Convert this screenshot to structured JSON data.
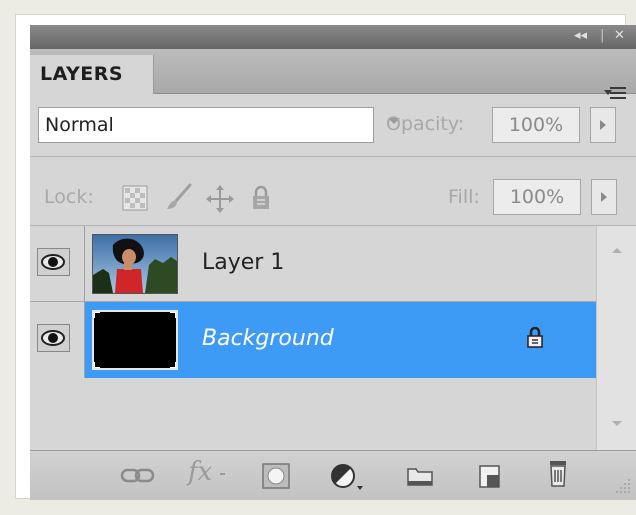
{
  "panel": {
    "title_controls": {
      "collapse": "◂◂",
      "close": "✕"
    },
    "tab_label": "LAYERS",
    "menu_icon": "panel-menu-icon"
  },
  "blend": {
    "mode": "Normal",
    "opacity_label": "Opacity:",
    "opacity_value": "100%"
  },
  "lock": {
    "label": "Lock:",
    "fill_label": "Fill:",
    "fill_value": "100%",
    "icons": [
      "lock-transparent-pixels-icon",
      "lock-image-pixels-icon",
      "lock-position-icon",
      "lock-all-icon"
    ]
  },
  "layers": [
    {
      "name": "Layer 1",
      "visible": true,
      "selected": false,
      "locked": false,
      "thumbnail": "photo-thumbnail"
    },
    {
      "name": "Background",
      "visible": true,
      "selected": true,
      "locked": true,
      "thumbnail": "black-thumbnail"
    }
  ],
  "bottom_icons": [
    "link-layers-icon",
    "fx-icon",
    "layer-mask-icon",
    "adjustment-layer-icon",
    "group-folder-icon",
    "new-layer-icon",
    "trash-icon"
  ],
  "bottom_labels": {
    "fx": "fx"
  },
  "colors": {
    "selection": "#3d9bf5",
    "panel_bg": "#d6d6d6",
    "titlebar": "#777777"
  }
}
